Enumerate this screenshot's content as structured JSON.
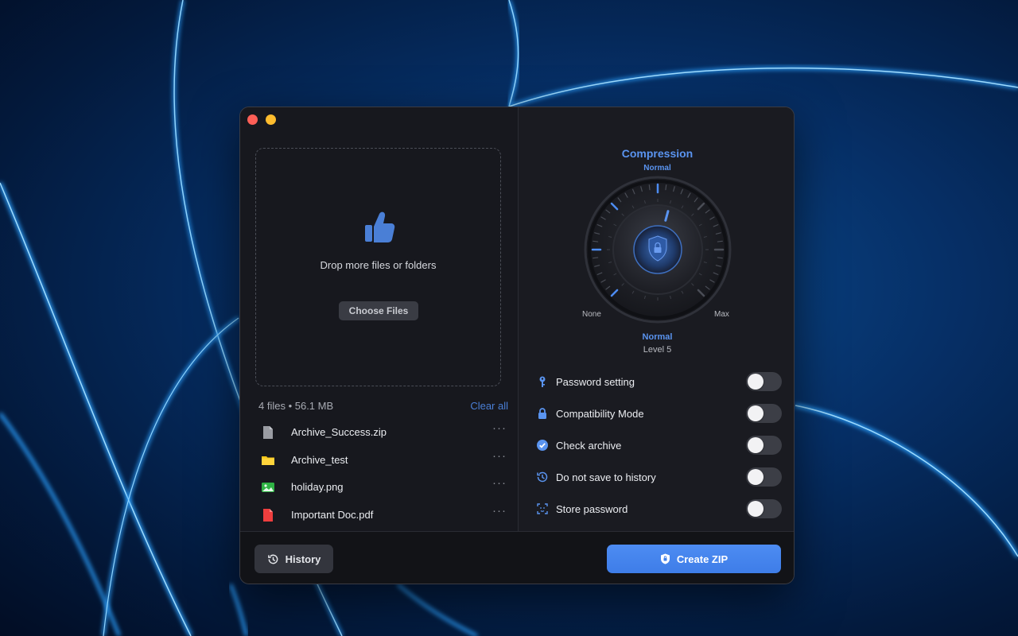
{
  "window": {
    "traffic_lights": [
      "close",
      "minimize"
    ]
  },
  "dropzone": {
    "icon": "thumbs-up-icon",
    "text": "Drop more files or folders",
    "choose_label": "Choose Files"
  },
  "file_list": {
    "summary": "4 files • 56.1 MB",
    "clear_label": "Clear all",
    "files": [
      {
        "name": "Archive_Success.zip",
        "icon": "zip-file-icon",
        "more": "···"
      },
      {
        "name": "Archive_test",
        "icon": "folder-icon",
        "more": "···"
      },
      {
        "name": "holiday.png",
        "icon": "image-file-icon",
        "more": "···"
      },
      {
        "name": "Important Doc.pdf",
        "icon": "pdf-file-icon",
        "more": "···"
      }
    ]
  },
  "compression": {
    "title": "Compression",
    "top_label": "Normal",
    "min_label": "None",
    "max_label": "Max",
    "level_name": "Normal",
    "level_text": "Level 5",
    "level_value": 5,
    "level_max": 9
  },
  "options": [
    {
      "label": "Password setting",
      "icon": "key-icon",
      "on": false
    },
    {
      "label": "Compatibility Mode",
      "icon": "lock-icon",
      "on": false
    },
    {
      "label": "Check archive",
      "icon": "check-badge-icon",
      "on": false
    },
    {
      "label": "Do not save to history",
      "icon": "history-icon",
      "on": false
    },
    {
      "label": "Store password",
      "icon": "face-scan-icon",
      "on": false
    }
  ],
  "footer": {
    "history_label": "History",
    "create_label": "Create ZIP"
  },
  "colors": {
    "accent": "#4d8cf2",
    "window_bg": "#17181e"
  }
}
